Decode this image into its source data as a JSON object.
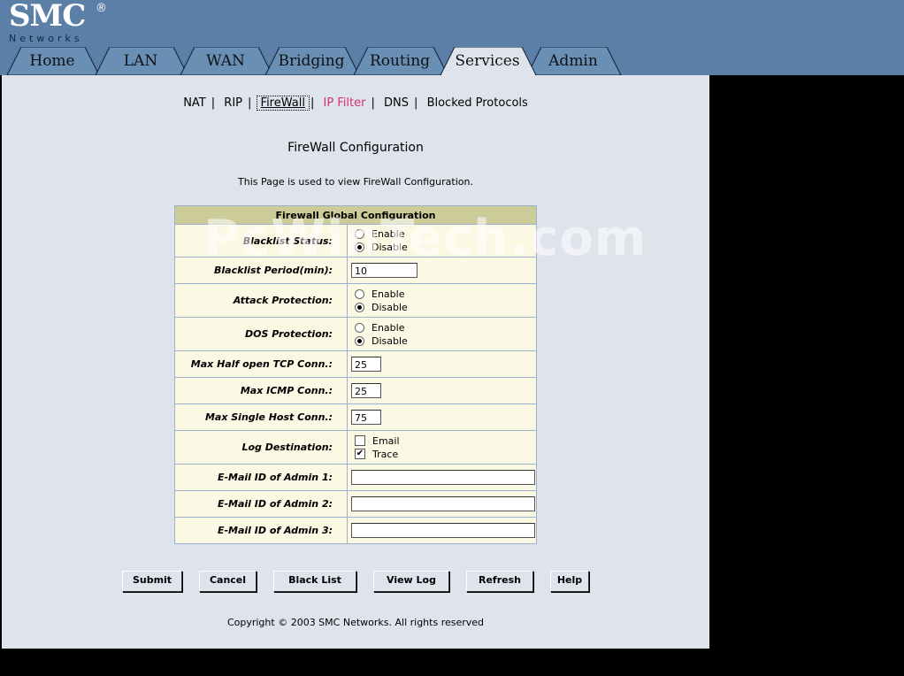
{
  "brand": {
    "name": "SMC",
    "reg": "®",
    "sub": "Networks"
  },
  "tabs": [
    {
      "label": "Home"
    },
    {
      "label": "LAN"
    },
    {
      "label": "WAN"
    },
    {
      "label": "Bridging"
    },
    {
      "label": "Routing"
    },
    {
      "label": "Services",
      "active": true
    },
    {
      "label": "Admin"
    }
  ],
  "subnav": [
    {
      "label": "NAT"
    },
    {
      "label": "RIP"
    },
    {
      "label": "FireWall",
      "active": true
    },
    {
      "label": "IP Filter"
    },
    {
      "label": "DNS"
    },
    {
      "label": "Blocked Protocols"
    }
  ],
  "page": {
    "title": "FireWall Configuration",
    "description": "This Page is used to view FireWall Configuration.",
    "watermark": "PcWinTech.com",
    "copyright": "Copyright © 2003 SMC Networks. All rights reserved"
  },
  "form": {
    "header": "Firewall Global Configuration",
    "blacklist_status": {
      "label": "Blacklist Status:",
      "options": [
        "Enable",
        "Disable"
      ],
      "selected": "Disable"
    },
    "blacklist_period": {
      "label": "Blacklist Period(min):",
      "value": "10"
    },
    "attack_protection": {
      "label": "Attack Protection:",
      "options": [
        "Enable",
        "Disable"
      ],
      "selected": "Disable"
    },
    "dos_protection": {
      "label": "DOS Protection:",
      "options": [
        "Enable",
        "Disable"
      ],
      "selected": "Disable"
    },
    "max_half_open": {
      "label": "Max Half open TCP Conn.:",
      "value": "25"
    },
    "max_icmp": {
      "label": "Max ICMP Conn.:",
      "value": "25"
    },
    "max_single_host": {
      "label": "Max Single Host Conn.:",
      "value": "75"
    },
    "log_destination": {
      "label": "Log Destination:",
      "email": "Email",
      "trace": "Trace",
      "email_checked": false,
      "trace_checked": true
    },
    "email_admin1": {
      "label": "E-Mail ID of Admin 1:",
      "value": ""
    },
    "email_admin2": {
      "label": "E-Mail ID of Admin 2:",
      "value": ""
    },
    "email_admin3": {
      "label": "E-Mail ID of Admin 3:",
      "value": ""
    }
  },
  "buttons": {
    "submit": "Submit",
    "cancel": "Cancel",
    "black_list": "Black List",
    "view_log": "View Log",
    "refresh": "Refresh",
    "help": "Help"
  },
  "colors": {
    "header": "#5b7fa6",
    "panel": "#dfe4ec",
    "table_header": "#cccc99",
    "row": "#fbf8e4",
    "link_pink": "#d6306e"
  }
}
